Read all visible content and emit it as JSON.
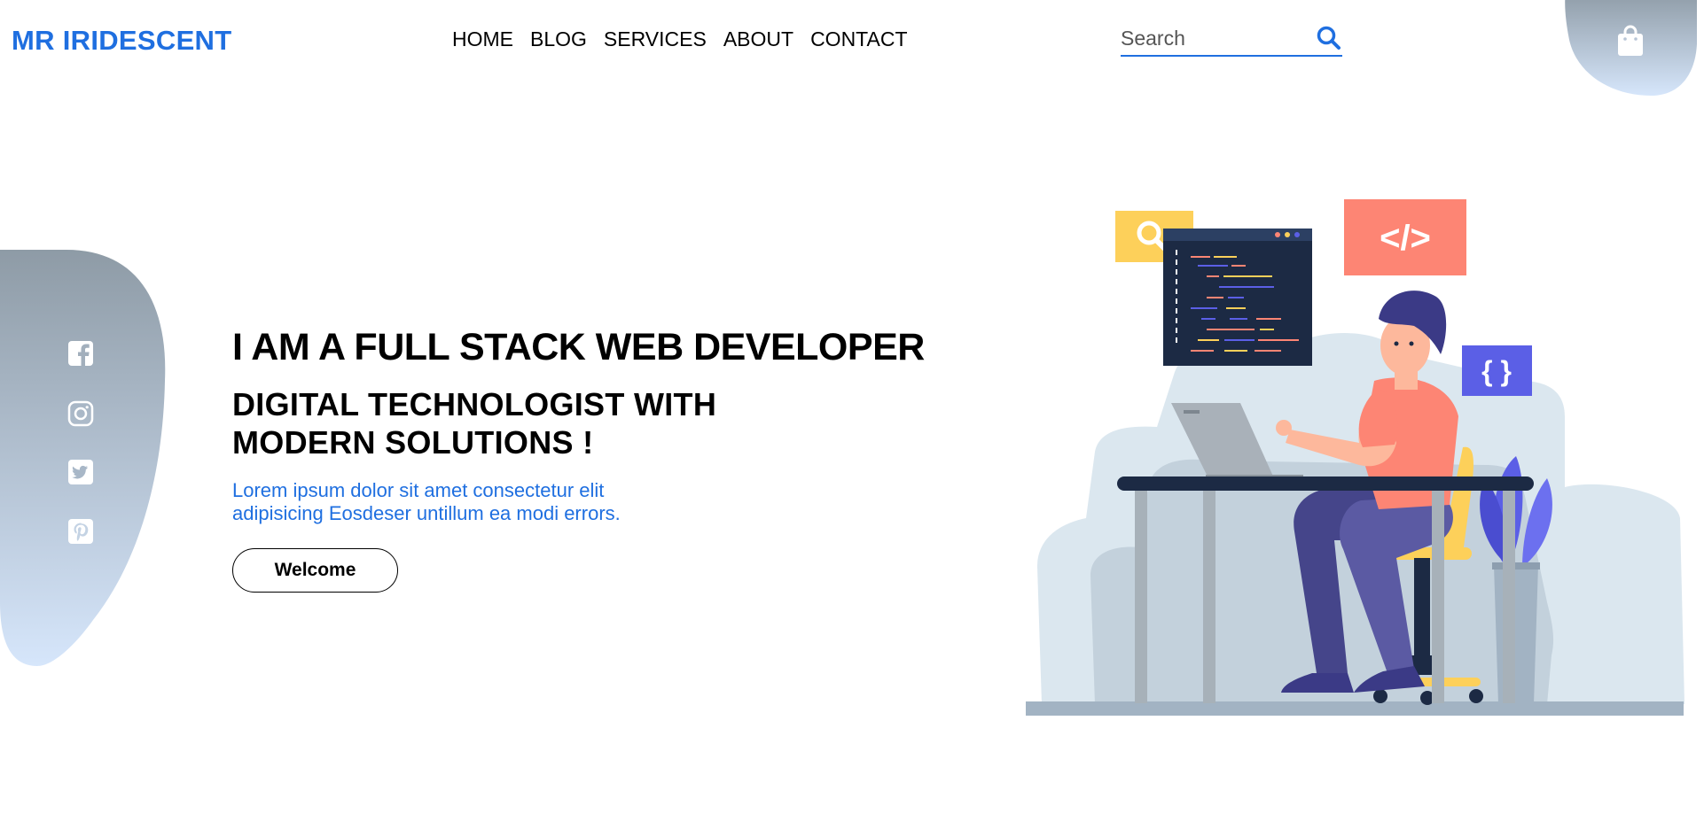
{
  "header": {
    "logo": "MR IRIDESCENT",
    "nav": [
      "HOME",
      "BLOG",
      "SERVICES",
      "ABOUT",
      "CONTACT"
    ],
    "search": {
      "placeholder": "Search"
    },
    "icons": {
      "search": "search-icon",
      "cart": "shopping-bag-icon"
    }
  },
  "social": [
    "facebook-icon",
    "instagram-icon",
    "twitter-icon",
    "pinterest-icon"
  ],
  "hero": {
    "headline": "I AM A FULL STACK WEB DEVELOPER",
    "subheadline": "DIGITAL TECHNOLOGIST WITH MODERN SOLUTIONS !",
    "description": "Lorem ipsum dolor sit amet consectetur elit adipisicing Eosdeser untillum ea modi errors.",
    "button": "Welcome"
  },
  "illustration": {
    "code_tag": "</>",
    "braces": "{ }"
  },
  "colors": {
    "accent": "#1f6fe0",
    "blob_top": "#8e9ba6",
    "blob_bottom": "#d6e6fb",
    "salmon": "#fd8574",
    "yellow": "#fdd05a",
    "navy": "#1c2a44",
    "purple": "#5b5fe6"
  }
}
